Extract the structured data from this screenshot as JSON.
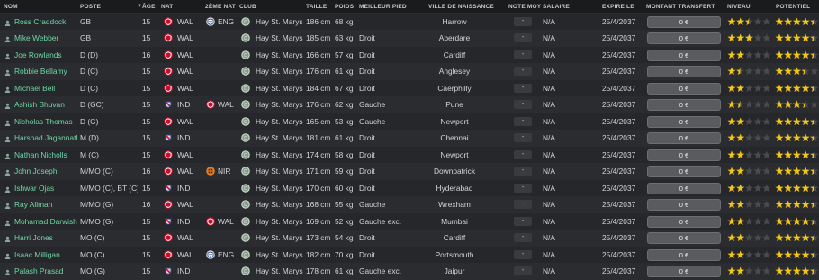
{
  "headers": {
    "nom": "NOM",
    "poste": "POSTE",
    "age": "ÂGE",
    "nat": "NAT",
    "nat2": "2ÈME NAT",
    "club": "CLUB",
    "taille": "TAILLE",
    "poids": "POIDS",
    "pied": "MEILLEUR PIED",
    "ville": "VILLE DE NAISSANCE",
    "note": "NOTE MOY",
    "salaire": "SALAIRE",
    "expire": "EXPIRE LE",
    "transfert": "MONTANT TRANSFERT",
    "niveau": "NIVEAU",
    "potentiel": "POTENTIEL"
  },
  "colors": {
    "name_text": "#6fd6a6",
    "star_filled": "#f3c614",
    "star_empty": "#4a4b4f"
  },
  "players": [
    {
      "name": "Ross Craddock",
      "poste": "GB",
      "age": "15",
      "nat": "WAL",
      "nat2": "ENG",
      "club": "Hay St. Marys",
      "taille": "186 cm",
      "poids": "68 kg",
      "pied": "",
      "ville": "Harrow",
      "note": "-",
      "salaire": "N/A",
      "expire": "25/4/2037",
      "transfert": "0 €",
      "niveau": 2.5,
      "potentiel": 4.5
    },
    {
      "name": "Mike Webber",
      "poste": "GB",
      "age": "15",
      "nat": "WAL",
      "nat2": "",
      "club": "Hay St. Marys",
      "taille": "185 cm",
      "poids": "63 kg",
      "pied": "Droit",
      "ville": "Aberdare",
      "note": "-",
      "salaire": "N/A",
      "expire": "25/4/2037",
      "transfert": "0 €",
      "niveau": 3,
      "potentiel": 4.5
    },
    {
      "name": "Joe Rowlands",
      "poste": "D (D)",
      "age": "16",
      "nat": "WAL",
      "nat2": "",
      "club": "Hay St. Marys",
      "taille": "166 cm",
      "poids": "57 kg",
      "pied": "Droit",
      "ville": "Cardiff",
      "note": "-",
      "salaire": "N/A",
      "expire": "25/4/2037",
      "transfert": "0 €",
      "niveau": 2,
      "potentiel": 4.5
    },
    {
      "name": "Robbie Bellamy",
      "poste": "D (C)",
      "age": "15",
      "nat": "WAL",
      "nat2": "",
      "club": "Hay St. Marys",
      "taille": "176 cm",
      "poids": "61 kg",
      "pied": "Droit",
      "ville": "Anglesey",
      "note": "-",
      "salaire": "N/A",
      "expire": "25/4/2037",
      "transfert": "0 €",
      "niveau": 1.5,
      "potentiel": 3.5
    },
    {
      "name": "Michael Bell",
      "poste": "D (C)",
      "age": "15",
      "nat": "WAL",
      "nat2": "",
      "club": "Hay St. Marys",
      "taille": "184 cm",
      "poids": "67 kg",
      "pied": "Droit",
      "ville": "Caerphilly",
      "note": "-",
      "salaire": "N/A",
      "expire": "25/4/2037",
      "transfert": "0 €",
      "niveau": 2,
      "potentiel": 4.5
    },
    {
      "name": "Ashish Bhuvan",
      "poste": "D (GC)",
      "age": "15",
      "nat": "IND",
      "nat2": "WAL",
      "club": "Hay St. Marys",
      "taille": "176 cm",
      "poids": "62 kg",
      "pied": "Gauche",
      "ville": "Pune",
      "note": "-",
      "salaire": "N/A",
      "expire": "25/4/2037",
      "transfert": "0 €",
      "niveau": 1.5,
      "potentiel": 3.5
    },
    {
      "name": "Nicholas Thomas",
      "poste": "D (G)",
      "age": "15",
      "nat": "WAL",
      "nat2": "",
      "club": "Hay St. Marys",
      "taille": "165 cm",
      "poids": "53 kg",
      "pied": "Gauche",
      "ville": "Newport",
      "note": "-",
      "salaire": "N/A",
      "expire": "25/4/2037",
      "transfert": "0 €",
      "niveau": 2,
      "potentiel": 4.5
    },
    {
      "name": "Harshad Jagannath",
      "poste": "M (D)",
      "age": "15",
      "nat": "IND",
      "nat2": "",
      "club": "Hay St. Marys",
      "taille": "181 cm",
      "poids": "61 kg",
      "pied": "Droit",
      "ville": "Chennai",
      "note": "-",
      "salaire": "N/A",
      "expire": "25/4/2037",
      "transfert": "0 €",
      "niveau": 2,
      "potentiel": 4.5
    },
    {
      "name": "Nathan Nicholls",
      "poste": "M (C)",
      "age": "15",
      "nat": "WAL",
      "nat2": "",
      "club": "Hay St. Marys",
      "taille": "174 cm",
      "poids": "58 kg",
      "pied": "Droit",
      "ville": "Newport",
      "note": "-",
      "salaire": "N/A",
      "expire": "25/4/2037",
      "transfert": "0 €",
      "niveau": 2,
      "potentiel": 4.5
    },
    {
      "name": "John Joseph",
      "poste": "M/MO (C)",
      "age": "16",
      "nat": "WAL",
      "nat2": "NIR",
      "club": "Hay St. Marys",
      "taille": "171 cm",
      "poids": "59 kg",
      "pied": "Droit",
      "ville": "Downpatrick",
      "note": "-",
      "salaire": "N/A",
      "expire": "25/4/2037",
      "transfert": "0 €",
      "niveau": 2,
      "potentiel": 4.5
    },
    {
      "name": "Ishwar Ojas",
      "poste": "M/MO (C), BT (C)",
      "age": "15",
      "nat": "IND",
      "nat2": "",
      "club": "Hay St. Marys",
      "taille": "170 cm",
      "poids": "60 kg",
      "pied": "Droit",
      "ville": "Hyderabad",
      "note": "-",
      "salaire": "N/A",
      "expire": "25/4/2037",
      "transfert": "0 €",
      "niveau": 2,
      "potentiel": 4.5
    },
    {
      "name": "Ray Allman",
      "poste": "M/MO (G)",
      "age": "16",
      "nat": "WAL",
      "nat2": "",
      "club": "Hay St. Marys",
      "taille": "168 cm",
      "poids": "55 kg",
      "pied": "Gauche",
      "ville": "Wrexham",
      "note": "-",
      "salaire": "N/A",
      "expire": "25/4/2037",
      "transfert": "0 €",
      "niveau": 2,
      "potentiel": 4.5
    },
    {
      "name": "Mohamad Darwish",
      "poste": "M/MO (G)",
      "age": "15",
      "nat": "IND",
      "nat2": "WAL",
      "club": "Hay St. Marys",
      "taille": "169 cm",
      "poids": "52 kg",
      "pied": "Gauche exc.",
      "ville": "Mumbai",
      "note": "-",
      "salaire": "N/A",
      "expire": "25/4/2037",
      "transfert": "0 €",
      "niveau": 2,
      "potentiel": 4.5
    },
    {
      "name": "Harri Jones",
      "poste": "MO (C)",
      "age": "15",
      "nat": "WAL",
      "nat2": "",
      "club": "Hay St. Marys",
      "taille": "173 cm",
      "poids": "54 kg",
      "pied": "Droit",
      "ville": "Cardiff",
      "note": "-",
      "salaire": "N/A",
      "expire": "25/4/2037",
      "transfert": "0 €",
      "niveau": 2,
      "potentiel": 4.5
    },
    {
      "name": "Isaac Milligan",
      "poste": "MO (C)",
      "age": "15",
      "nat": "WAL",
      "nat2": "ENG",
      "club": "Hay St. Marys",
      "taille": "182 cm",
      "poids": "70 kg",
      "pied": "Droit",
      "ville": "Portsmouth",
      "note": "-",
      "salaire": "N/A",
      "expire": "25/4/2037",
      "transfert": "0 €",
      "niveau": 2,
      "potentiel": 4.5
    },
    {
      "name": "Palash Prasad",
      "poste": "MO (G)",
      "age": "15",
      "nat": "IND",
      "nat2": "",
      "club": "Hay St. Marys",
      "taille": "178 cm",
      "poids": "61 kg",
      "pied": "Gauche exc.",
      "ville": "Jaipur",
      "note": "-",
      "salaire": "N/A",
      "expire": "25/4/2037",
      "transfert": "0 €",
      "niveau": 2,
      "potentiel": 4.5
    }
  ]
}
